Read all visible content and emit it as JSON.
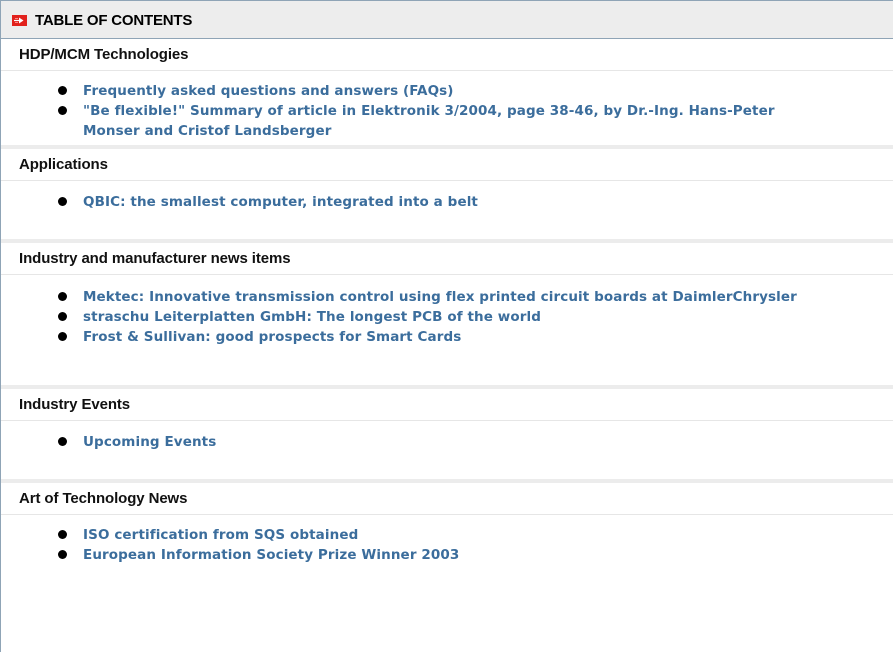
{
  "toc": {
    "title": "TABLE OF CONTENTS",
    "icon": "red-arrow-icon",
    "accent_color": "#e2211c",
    "link_color": "#3b6d9c"
  },
  "sections": [
    {
      "heading": "HDP/MCM Technologies",
      "items": [
        {
          "label": "Frequently asked questions and answers (FAQs)"
        },
        {
          "label": "\"Be flexible!\" Summary of article in Elektronik 3/2004, page 38-46, by Dr.-Ing. Hans-Peter Monser and Cristof Landsberger"
        }
      ]
    },
    {
      "heading": "Applications",
      "items": [
        {
          "label": "QBIC: the smallest computer, integrated into a belt"
        }
      ]
    },
    {
      "heading": "Industry and manufacturer news items",
      "items": [
        {
          "label": "Mektec: Innovative transmission control using flex printed circuit boards at DaimlerChrysler"
        },
        {
          "label": "straschu Leiterplatten GmbH: The longest PCB of the world"
        },
        {
          "label": "Frost & Sullivan: good prospects for Smart Cards"
        }
      ]
    },
    {
      "heading": "Industry Events",
      "items": [
        {
          "label": "Upcoming Events"
        }
      ]
    },
    {
      "heading": "Art of Technology News",
      "items": [
        {
          "label": "ISO certification from SQS obtained"
        },
        {
          "label": "European Information Society Prize Winner 2003"
        }
      ]
    }
  ]
}
